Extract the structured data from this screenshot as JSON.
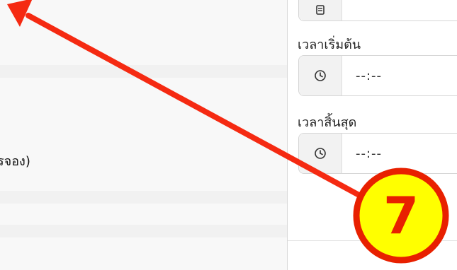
{
  "left": {
    "partial_text": "รจอง)"
  },
  "form": {
    "start_time": {
      "label": "เวลาเริ่มต้น",
      "value": "--:--"
    },
    "end_time": {
      "label": "เวลาสิ้นสุด",
      "value": "--:--"
    }
  },
  "annotation": {
    "step_number": "7",
    "arrow_color": "#f52a12",
    "badge_fill": "#ffff00",
    "badge_stroke": "#e82000"
  }
}
